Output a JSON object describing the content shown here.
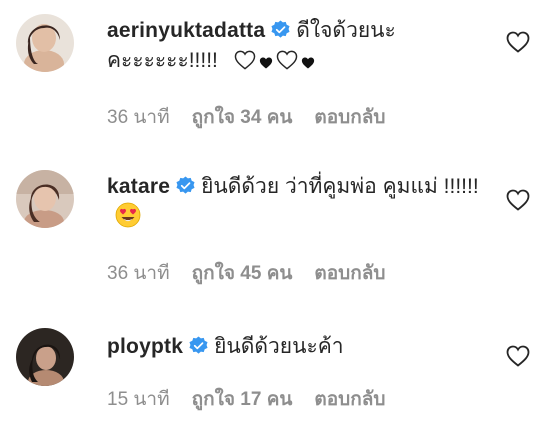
{
  "comments": [
    {
      "username": "aerinyuktadatta",
      "verified": true,
      "text": "ดีใจด้วยนะคะะะะะะ!!!!!",
      "hearts": [
        "white-heart-icon",
        "black-heart-icon",
        "white-heart-icon",
        "black-heart-icon"
      ],
      "time": "36 นาที",
      "likes": "ถูกใจ 34 คน",
      "reply": "ตอบกลับ"
    },
    {
      "username": "katare",
      "verified": true,
      "text": "ยินดีด้วย ว่าที่คูมพ่อ คูมแม่ !!!!!!",
      "emoji": "heart-eyes-emoji",
      "time": "36 นาที",
      "likes": "ถูกใจ 45 คน",
      "reply": "ตอบกลับ"
    },
    {
      "username": "ploypt​k",
      "verified": true,
      "text": "ยินดีด้วยนะค้า",
      "time": "15 นาที",
      "likes": "ถูกใจ 17 คน",
      "reply": "ตอบกลับ"
    }
  ],
  "colors": {
    "text": "#262626",
    "secondary": "#8e8e8e",
    "verified": "#3897f0"
  }
}
